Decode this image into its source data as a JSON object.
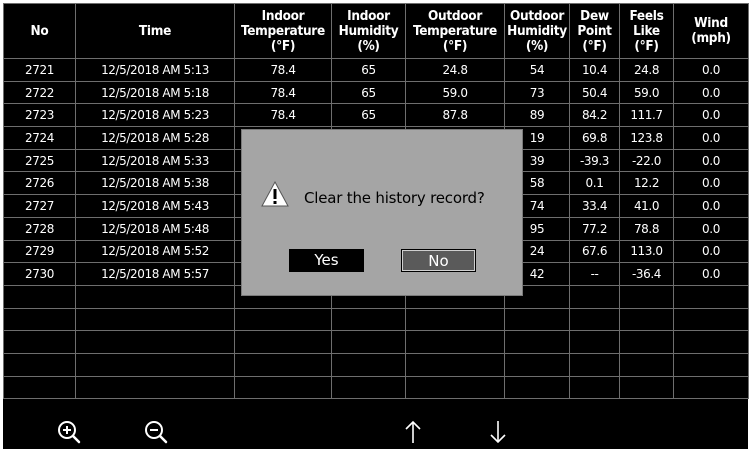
{
  "table": {
    "headers": [
      "No",
      "Time",
      "Indoor Temperature (°F)",
      "Indoor Humidity (%)",
      "Outdoor Temperature (°F)",
      "Outdoor Humidity (%)",
      "Dew Point (°F)",
      "Feels Like (°F)",
      "Wind (mph)"
    ],
    "rows": [
      [
        "2721",
        "12/5/2018 AM 5:13",
        "78.4",
        "65",
        "24.8",
        "54",
        "10.4",
        "24.8",
        "0.0"
      ],
      [
        "2722",
        "12/5/2018 AM 5:18",
        "78.4",
        "65",
        "59.0",
        "73",
        "50.4",
        "59.0",
        "0.0"
      ],
      [
        "2723",
        "12/5/2018 AM 5:23",
        "78.4",
        "65",
        "87.8",
        "89",
        "84.2",
        "111.7",
        "0.0"
      ],
      [
        "2724",
        "12/5/2018 AM 5:28",
        "",
        "",
        "",
        "19",
        "69.8",
        "123.8",
        "0.0"
      ],
      [
        "2725",
        "12/5/2018 AM 5:33",
        "",
        "",
        "",
        "39",
        "-39.3",
        "-22.0",
        "0.0"
      ],
      [
        "2726",
        "12/5/2018 AM 5:38",
        "",
        "",
        "",
        "58",
        "0.1",
        "12.2",
        "0.0"
      ],
      [
        "2727",
        "12/5/2018 AM 5:43",
        "",
        "",
        "",
        "74",
        "33.4",
        "41.0",
        "0.0"
      ],
      [
        "2728",
        "12/5/2018 AM 5:48",
        "",
        "",
        "",
        "95",
        "77.2",
        "78.8",
        "0.0"
      ],
      [
        "2729",
        "12/5/2018 AM 5:52",
        "",
        "",
        "",
        "24",
        "67.6",
        "113.0",
        "0.0"
      ],
      [
        "2730",
        "12/5/2018 AM 5:57",
        "",
        "",
        "",
        "42",
        "--",
        "-36.4",
        "0.0"
      ],
      [
        "",
        "",
        "",
        "",
        "",
        "",
        "",
        "",
        ""
      ],
      [
        "",
        "",
        "",
        "",
        "",
        "",
        "",
        "",
        ""
      ],
      [
        "",
        "",
        "",
        "",
        "",
        "",
        "",
        "",
        ""
      ],
      [
        "",
        "",
        "",
        "",
        "",
        "",
        "",
        "",
        ""
      ],
      [
        "",
        "",
        "",
        "",
        "",
        "",
        "",
        "",
        ""
      ]
    ]
  },
  "toolbar": {
    "zoom_in_icon": "zoom-in-icon",
    "zoom_out_icon": "zoom-out-icon",
    "up_arrow": "↑",
    "down_arrow": "↓"
  },
  "dialog": {
    "message": "Clear the history record?",
    "yes_label": "Yes",
    "no_label": "No",
    "icon": "warning-icon"
  },
  "colors": {
    "background": "#000000",
    "text": "#ffffff",
    "grid": "#6e6e6e",
    "dialog_bg": "#a5a5a5",
    "button_focus": "#5a5a5a"
  }
}
